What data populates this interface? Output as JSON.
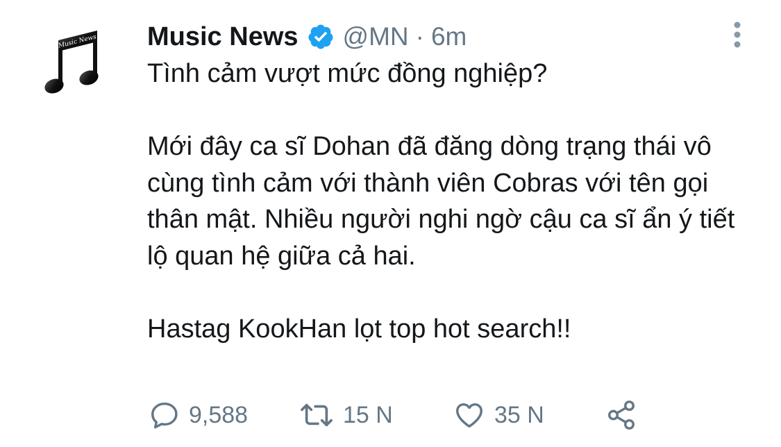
{
  "tweet": {
    "display_name": "Music News",
    "handle": "@MN",
    "separator": "·",
    "time": "6m",
    "avatar_text": "Music News",
    "body": {
      "line1": "Tình cảm vượt mức đồng nghiệp?",
      "paragraph2": "Mới đây ca sĩ Dohan đã đăng dòng trạng thái vô cùng tình cảm với thành viên Cobras với tên gọi thân mật. Nhiều người nghi ngờ cậu ca sĩ ẩn ý tiết lộ quan hệ giữa cả hai.",
      "paragraph3": "Hastag KookHan lọt top hot search!!"
    },
    "actions": {
      "replies": "9,588",
      "retweets": "15 N",
      "likes": "35 N"
    }
  },
  "colors": {
    "text": "#14171a",
    "secondary": "#657786",
    "verified": "#1da1f2"
  },
  "icons": {
    "avatar": "music-note-icon",
    "verified": "verified-badge-icon",
    "more": "more-vertical-icon",
    "reply": "reply-icon",
    "retweet": "retweet-icon",
    "like": "heart-icon",
    "share": "share-icon"
  }
}
